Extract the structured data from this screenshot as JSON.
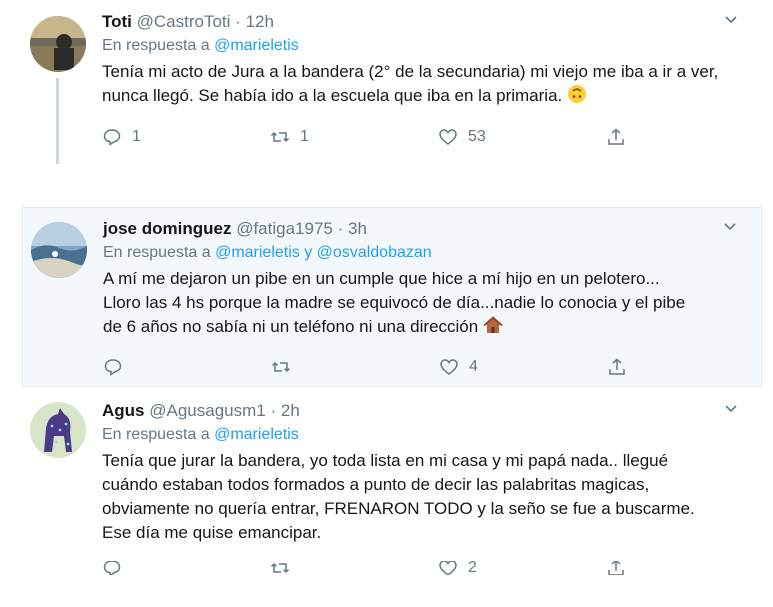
{
  "tweets": [
    {
      "name": "Toti",
      "handle": "@CastroToti",
      "dot": "·",
      "time": "12h",
      "reply_prefix": "En respuesta a",
      "mentions": "@marieletis",
      "text": "Tenía mi acto de Jura a la bandera (2° de la secundaria) mi viejo me iba a ir a ver, nunca llegó. Se había ido a la escuela que iba en la primaria.",
      "emoji": "upside-down-face-icon",
      "reply_count": "1",
      "retweet_count": "1",
      "like_count": "53"
    },
    {
      "name": "jose dominguez",
      "handle": "@fatiga1975",
      "dot": "·",
      "time": "3h",
      "reply_prefix": "En respuesta a",
      "mentions": "@marieletis y @osvaldobazan",
      "text_lines": [
        "A mí me dejaron un pibe en un cumple que hice  a mí hijo en un pelotero...",
        "Lloro las 4 hs porque la madre se equivocó de día...nadie lo conocia y el pibe",
        "de 6 años no sabía ni un teléfono ni una dirección"
      ],
      "emoji": "house-icon",
      "reply_count": "",
      "retweet_count": "",
      "like_count": "4"
    },
    {
      "name": "Agus",
      "handle": "@Agusagusm1",
      "dot": "·",
      "time": "2h",
      "reply_prefix": "En respuesta a",
      "mentions": "@marieletis",
      "text_lines": [
        "Tenía que jurar la bandera, yo toda lista en mi casa y mi papá nada.. llegué",
        "cuándo estaban todos formados a punto de decir las palabritas magicas,",
        "obviamente no quería entrar, FRENARON TODO y la seño se fue a buscarme.",
        "Ese día me quise emancipar."
      ],
      "like_count": "2"
    }
  ],
  "colors": {
    "text": "#14171a",
    "muted": "#657786",
    "link": "#1da1f2",
    "highlight_bg": "#f5f8fa"
  }
}
